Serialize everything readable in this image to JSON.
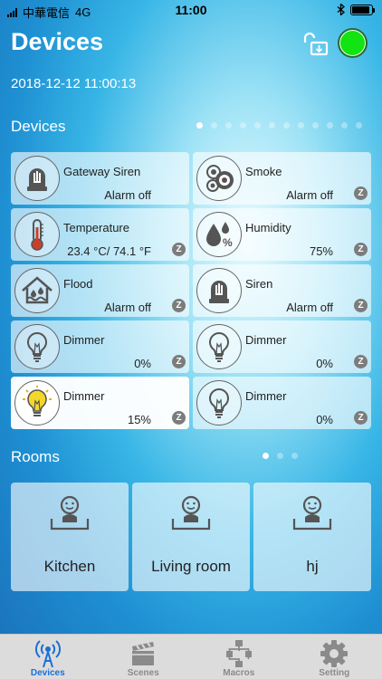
{
  "status_bar": {
    "carrier": "中華電信",
    "network": "4G",
    "time": "11:00"
  },
  "header": {
    "title": "Devices",
    "datetime": "2018-12-12 11:00:13",
    "connection_color": "#12e312"
  },
  "devices_section": {
    "title": "Devices",
    "page_count": 12,
    "active_page": 1,
    "items": [
      {
        "name": "Gateway Siren",
        "value": "Alarm off",
        "icon": "siren-icon",
        "zwave": false,
        "on": false
      },
      {
        "name": "Smoke",
        "value": "Alarm off",
        "icon": "smoke-icon",
        "zwave": true,
        "on": false
      },
      {
        "name": "Temperature",
        "value": "23.4 °C/ 74.1 °F",
        "icon": "thermometer-icon",
        "zwave": true,
        "on": false
      },
      {
        "name": "Humidity",
        "value": "75%",
        "icon": "humidity-icon",
        "zwave": true,
        "on": false
      },
      {
        "name": "Flood",
        "value": "Alarm off",
        "icon": "flood-icon",
        "zwave": true,
        "on": false
      },
      {
        "name": "Siren",
        "value": "Alarm off",
        "icon": "siren-icon",
        "zwave": true,
        "on": false
      },
      {
        "name": "Dimmer",
        "value": "0%",
        "icon": "bulb-icon",
        "zwave": true,
        "on": false
      },
      {
        "name": "Dimmer",
        "value": "0%",
        "icon": "bulb-icon",
        "zwave": true,
        "on": false
      },
      {
        "name": "Dimmer",
        "value": "15%",
        "icon": "bulb-on-icon",
        "zwave": true,
        "on": true
      },
      {
        "name": "Dimmer",
        "value": "0%",
        "icon": "bulb-icon",
        "zwave": true,
        "on": false
      }
    ],
    "zwave_badge": "Z"
  },
  "rooms_section": {
    "title": "Rooms",
    "page_count": 3,
    "active_page": 1,
    "items": [
      {
        "name": "Kitchen",
        "icon": "room-icon"
      },
      {
        "name": "Living room",
        "icon": "room-icon"
      },
      {
        "name": "hj",
        "icon": "room-icon"
      }
    ]
  },
  "tabbar": {
    "active": "Devices",
    "active_color": "#1a6fd6",
    "tabs": [
      {
        "label": "Devices",
        "icon": "antenna-icon"
      },
      {
        "label": "Scenes",
        "icon": "clapperboard-icon"
      },
      {
        "label": "Macros",
        "icon": "flowchart-icon"
      },
      {
        "label": "Setting",
        "icon": "gear-icon"
      }
    ]
  }
}
